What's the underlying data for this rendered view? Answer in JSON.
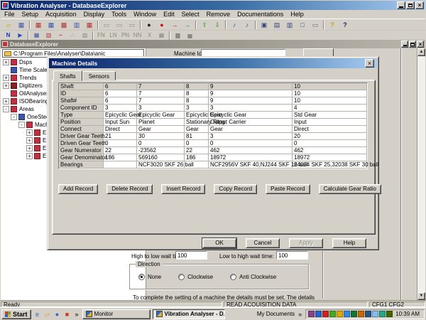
{
  "window": {
    "title": "Vibration Analyser - DatabaseExplorer"
  },
  "glyphs": {
    "close": "×",
    "up_arrow": "▲",
    "down_arrow": "▼",
    "chevron": "»"
  },
  "menu": {
    "items": [
      "File",
      "Setup",
      "Acquisition",
      "Display",
      "Tools",
      "Window",
      "Edit",
      "Select",
      "Remove",
      "Documentations",
      "Help"
    ]
  },
  "toolbar1": [
    {
      "n": "open-folder-icon",
      "g": "▱",
      "c": "#caa21a"
    },
    {
      "n": "save-monitor-icon",
      "g": "▦",
      "c": "#3a55a8"
    },
    {
      "sep": true
    },
    {
      "n": "chart-red-icon",
      "g": "▦",
      "c": "#b03030"
    },
    {
      "n": "chart-blue-icon",
      "g": "▦",
      "c": "#3a55a8"
    },
    {
      "n": "chart-line-icon",
      "g": "▩",
      "c": "#b03030"
    },
    {
      "n": "grid-blue-icon",
      "g": "▥",
      "c": "#3a55a8"
    },
    {
      "n": "grid-plus-icon",
      "g": "▦",
      "c": "#b03030"
    },
    {
      "sep": true
    },
    {
      "n": "layout-a-icon",
      "g": "▭",
      "c": "#8a887f"
    },
    {
      "n": "layout-b-icon",
      "g": "▭",
      "c": "#8a887f"
    },
    {
      "n": "layout-c-icon",
      "g": "▭",
      "c": "#8a887f"
    },
    {
      "sep": true
    },
    {
      "n": "record-icon",
      "g": "●",
      "c": "#202020"
    },
    {
      "n": "stop-icon",
      "g": "●",
      "c": "#cc1111"
    },
    {
      "n": "step-forward-icon",
      "g": "→",
      "c": "#cc2211"
    },
    {
      "n": "step-into-icon",
      "g": "→",
      "c": "#2a8a2a"
    },
    {
      "sep": true
    },
    {
      "n": "move-up-icon",
      "g": "⇧",
      "c": "#18a018"
    },
    {
      "n": "move-down-icon",
      "g": "⇩",
      "c": "#18a018"
    },
    {
      "sep": true
    },
    {
      "n": "key-blue-a-icon",
      "g": "♪",
      "c": "#2a4ac0"
    },
    {
      "n": "key-blue-b-icon",
      "g": "♪",
      "c": "#2a4ac0"
    },
    {
      "sep": true
    },
    {
      "n": "window-image-icon",
      "g": "▣",
      "c": "#33447a"
    },
    {
      "n": "split-horizontal-icon",
      "g": "▤",
      "c": "#33447a"
    },
    {
      "n": "split-vertical-icon",
      "g": "▥",
      "c": "#33447a"
    },
    {
      "n": "window-cascade-icon",
      "g": "□",
      "c": "#33447a"
    },
    {
      "n": "printer-icon",
      "g": "▭",
      "c": "#6a6a6a"
    },
    {
      "sep": true
    },
    {
      "n": "key-question-icon",
      "g": "?",
      "c": "#caa21a",
      "bold": true
    },
    {
      "n": "context-help-icon",
      "g": "?",
      "c": "#202060",
      "bold": true
    }
  ],
  "toolbar2": [
    {
      "n": "normal-icon",
      "g": "N",
      "c": "#1a35c8",
      "bold": true
    },
    {
      "n": "annotate-icon",
      "g": "▶",
      "c": "#2a4ac0"
    },
    {
      "sep": true
    },
    {
      "n": "picture-icon",
      "g": "▦",
      "c": "#3a55a8"
    },
    {
      "n": "bars-icon",
      "g": "▥",
      "c": "#b03030"
    },
    {
      "n": "wave-icon",
      "g": "~",
      "c": "#b03030",
      "bold": true
    },
    {
      "n": "scatter-icon",
      "g": "∴",
      "c": "#8a887f"
    },
    {
      "n": "edit-plot-icon",
      "g": "▨",
      "c": "#8a887f"
    },
    {
      "sep": true
    },
    {
      "n": "fn-icon",
      "g": "FN",
      "c": "#8a887f"
    },
    {
      "n": "ln-icon",
      "g": "LN",
      "c": "#8a887f"
    },
    {
      "n": "pn-icon",
      "g": "PN",
      "c": "#8a887f"
    },
    {
      "n": "nn-icon",
      "g": "NN",
      "c": "#8a887f"
    },
    {
      "n": "mean-icon",
      "g": "X",
      "c": "#8a887f"
    },
    {
      "n": "table-small-icon",
      "g": "▦",
      "c": "#8a887f"
    },
    {
      "sep": true
    },
    {
      "n": "peak-icon",
      "g": "▆",
      "c": "#8a887f"
    },
    {
      "n": "histogram-icon",
      "g": "▅",
      "c": "#8a887f"
    }
  ],
  "mdi": {
    "title": "DatabaseExplorer"
  },
  "tree": {
    "root": "C:\\Program Files\\Analyser\\Data\\anic",
    "items": [
      {
        "label": "Dsps",
        "level": 1,
        "exp": "+",
        "color": "#c03040"
      },
      {
        "label": "Time Scales",
        "level": 1,
        "exp": "",
        "color": "#3a55a8"
      },
      {
        "label": "Trends",
        "level": 1,
        "exp": "+",
        "color": "#c03040"
      },
      {
        "label": "Digitizers",
        "level": 1,
        "exp": "+",
        "color": "#8a2020"
      },
      {
        "label": "OilAnalysers",
        "level": 1,
        "exp": "",
        "color": "#c03040"
      },
      {
        "label": "ISOBearings",
        "level": 1,
        "exp": "+",
        "color": "#c03040"
      },
      {
        "label": "Areas",
        "level": 1,
        "exp": "-",
        "color": "#c03040"
      },
      {
        "label": "OneStee",
        "level": 2,
        "exp": "-",
        "color": "#3a55a8"
      },
      {
        "label": "Mach",
        "level": 3,
        "exp": "-",
        "color": "#c03040"
      },
      {
        "label": "E",
        "level": 4,
        "exp": "+",
        "color": "#c03040"
      },
      {
        "label": "E",
        "level": 4,
        "exp": "+",
        "color": "#c03040"
      },
      {
        "label": "E",
        "level": 4,
        "exp": "+",
        "color": "#c03040"
      },
      {
        "label": "E",
        "level": 4,
        "exp": "+",
        "color": "#c03040"
      }
    ]
  },
  "machine_form": {
    "machine_id_label": "Machine Id",
    "high_low_label": "High to low wait time:",
    "high_low_value": "100",
    "low_high_label": "Low to high wait time:",
    "low_high_value": "100",
    "direction_label": "Direction",
    "direction_options": [
      {
        "label": "None",
        "selected": true
      },
      {
        "label": "Clockwise",
        "selected": false
      },
      {
        "label": "Anti Clockwise",
        "selected": false
      }
    ],
    "note": "To complete the setting of a machine the details must be set. The details"
  },
  "dialog": {
    "title": "Machine Details",
    "tabs": [
      {
        "label": "Shafts",
        "active": true
      },
      {
        "label": "Sensors",
        "active": false
      }
    ],
    "table": {
      "rows": [
        {
          "label": "Shaft",
          "values": [
            "6",
            "7",
            "8",
            "9",
            "10"
          ]
        },
        {
          "label": "ID",
          "values": [
            "6",
            "7",
            "8",
            "9",
            "10"
          ]
        },
        {
          "label": "Shaft#",
          "values": [
            "6",
            "7",
            "8",
            "9",
            "10"
          ]
        },
        {
          "label": "Component ID",
          "values": [
            "3",
            "3",
            "3",
            "3",
            "4"
          ]
        },
        {
          "label": "Type",
          "values": [
            "Epicyclic Gear",
            "Epicyclic Gear",
            "Epicyclic Gear",
            "Epicyclic Gear",
            "Std Gear"
          ]
        },
        {
          "label": "Position",
          "values": [
            "Input Sun",
            "Planet",
            "Stationary Ring",
            "Output Carrier",
            "Input"
          ]
        },
        {
          "label": "Connect",
          "values": [
            "Direct",
            "Gear",
            "Gear",
            "Gear",
            "Direct"
          ]
        },
        {
          "label": "Driver Gear Teeth",
          "values": [
            "21",
            "30",
            "81",
            "3",
            "20"
          ]
        },
        {
          "label": "Driven Gear Teeth",
          "values": [
            "0",
            "0",
            "0",
            "0",
            "0"
          ]
        },
        {
          "label": "Gear Numerator",
          "values": [
            "22",
            "-23562",
            "22",
            "462",
            "462"
          ]
        },
        {
          "label": "Gear Denominator",
          "values": [
            "186",
            "569160",
            "186",
            "18972",
            "18972"
          ]
        },
        {
          "label": "Bearings",
          "values": [
            "",
            "NCF3020 SKF 26 ball",
            "",
            "NCF2956V SKF 40,NJ244 SKF 16 ball",
            "24034 SKF 25,32038 SKF 30 ball"
          ]
        }
      ]
    },
    "record_buttons": [
      "Add Record",
      "Delete Record",
      "Insert Record",
      "Copy Record",
      "Paste Record"
    ],
    "calculate_button": "Calculate Gear Ratio",
    "action_buttons": [
      {
        "label": "OK",
        "default": true
      },
      {
        "label": "Cancel"
      },
      {
        "label": "Apply",
        "disabled": true
      },
      {
        "label": "Help"
      }
    ]
  },
  "statusbar": {
    "ready": "Ready",
    "message": "READ ACQUISITION DATA",
    "config": "CFG1 CFG2"
  },
  "taskbar": {
    "start_label": "Start",
    "quick_launch": [
      {
        "n": "ie-icon",
        "g": "e",
        "c": "#2a66cc"
      },
      {
        "n": "mail-folder-icon",
        "g": "▱",
        "c": "#caa21a"
      },
      {
        "n": "globe-icon",
        "g": "●",
        "c": "#2a66cc"
      },
      {
        "n": "media-icon",
        "g": "■",
        "c": "#cc3a1a"
      }
    ],
    "tasks": [
      {
        "label": "Monitor",
        "active": false
      },
      {
        "label": "Vibration Analyser - D...",
        "active": true
      }
    ],
    "my_documents_label": "My Documents",
    "clock": "10:39 AM",
    "tray_colors": [
      "#884488",
      "#2266cc",
      "#cc2222",
      "#44aa22",
      "#ddaa00",
      "#3388dd",
      "#117733",
      "#cc6600",
      "#225588",
      "#88bbee",
      "#22aa88",
      "#446600"
    ]
  }
}
